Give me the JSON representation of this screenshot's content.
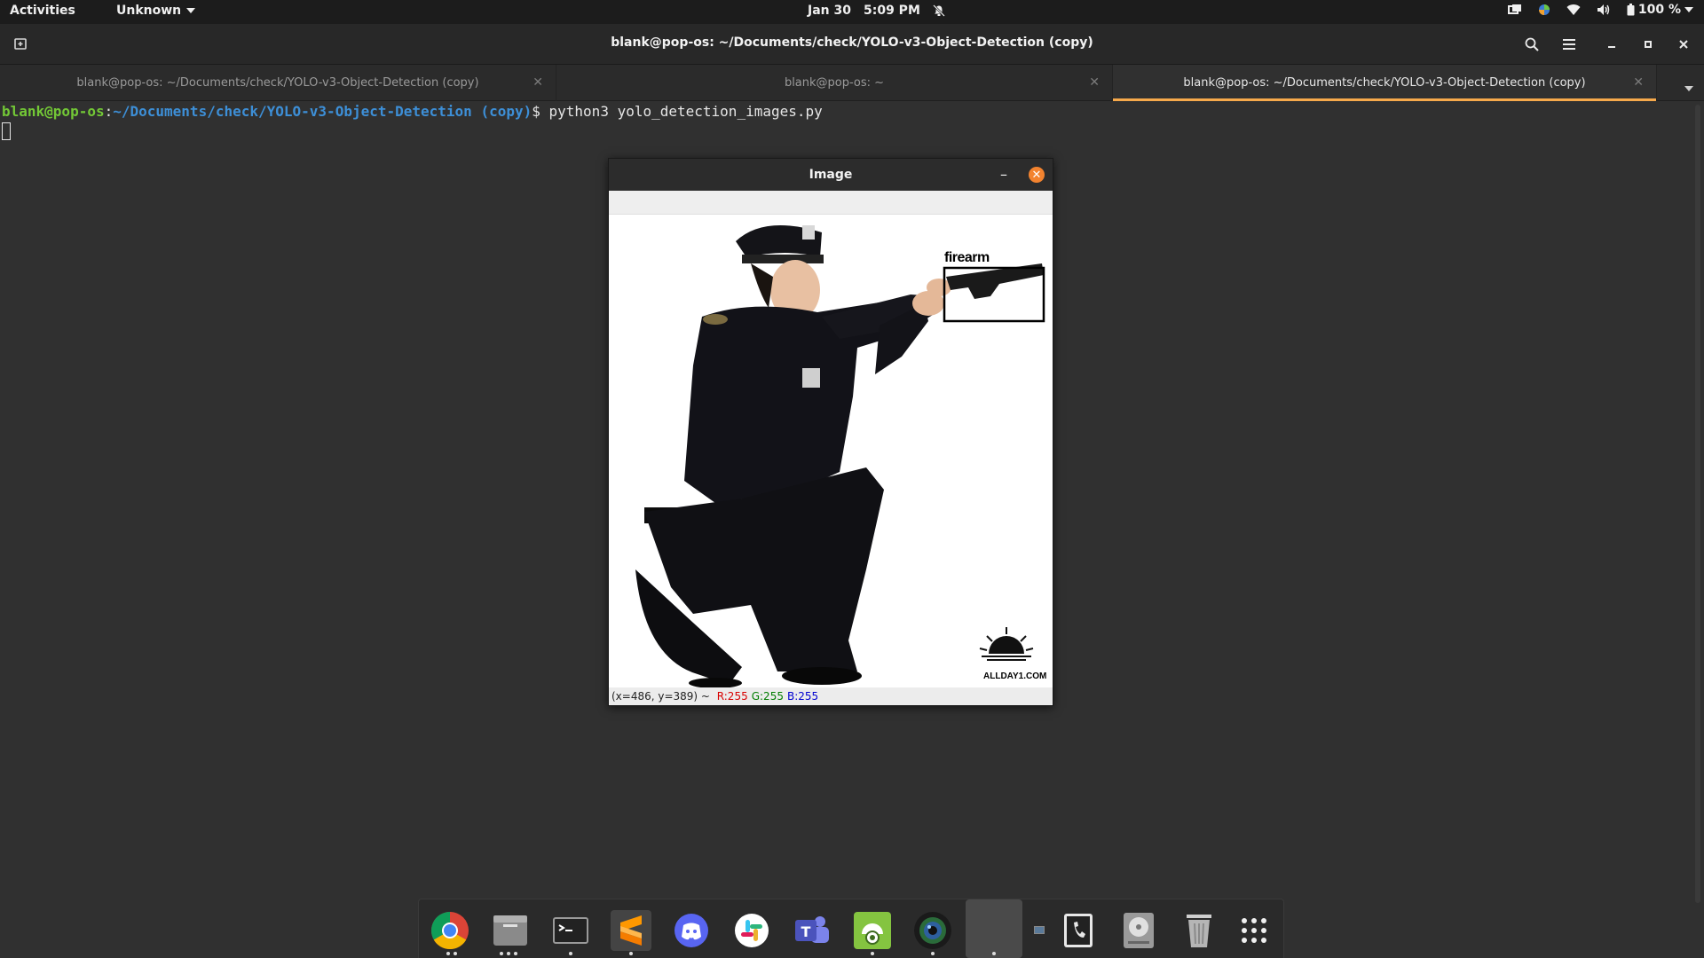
{
  "top_panel": {
    "activities": "Activities",
    "app_menu": "Unknown",
    "date": "Jan 30",
    "time": "5:09 PM",
    "battery": "100 %"
  },
  "terminal_window": {
    "title": "blank@pop-os: ~/Documents/check/YOLO-v3-Object-Detection (copy)",
    "tabs": [
      {
        "label": "blank@pop-os: ~/Documents/check/YOLO-v3-Object-Detection (copy)",
        "active": false
      },
      {
        "label": "blank@pop-os: ~",
        "active": false
      },
      {
        "label": "blank@pop-os: ~/Documents/check/YOLO-v3-Object-Detection (copy)",
        "active": true
      }
    ],
    "prompt": {
      "user_host": "blank@pop-os",
      "separator": ":",
      "path": "~/Documents/check/YOLO-v3-Object-Detection (copy)",
      "symbol": "$ ",
      "command": "python3 yolo_detection_images.py"
    }
  },
  "image_window": {
    "title": "Image",
    "detection_label": "firearm",
    "watermark": "ALLDAY1.COM",
    "status": {
      "coords": "(x=486, y=389) ~ ",
      "r": "R:255",
      "g": "G:255",
      "b": "B:255"
    }
  },
  "dock": {
    "items": [
      {
        "name": "chrome-icon",
        "dots": 2
      },
      {
        "name": "files-icon",
        "dots": 3
      },
      {
        "name": "terminal-icon",
        "dots": 1
      },
      {
        "name": "sublime-icon",
        "dots": 1
      },
      {
        "name": "discord-icon",
        "dots": 0
      },
      {
        "name": "slack-icon",
        "dots": 0
      },
      {
        "name": "teams-icon",
        "dots": 0
      },
      {
        "name": "android-studio-icon",
        "dots": 1
      },
      {
        "name": "camera-icon",
        "dots": 1
      },
      {
        "name": "image-viewer-icon",
        "dots": 1
      },
      {
        "name": "phone-icon",
        "dots": 0
      },
      {
        "name": "disk-icon",
        "dots": 0
      },
      {
        "name": "trash-icon",
        "dots": 0
      },
      {
        "name": "app-grid-icon",
        "dots": 0
      }
    ]
  }
}
